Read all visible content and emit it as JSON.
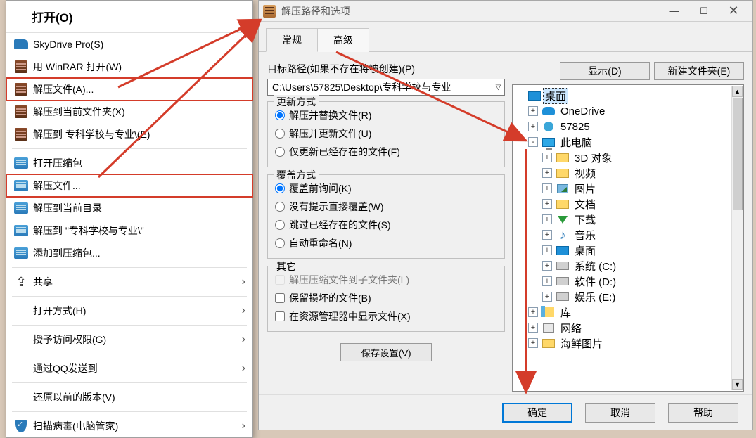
{
  "context_menu": {
    "header": "打开(O)",
    "items": [
      {
        "label": "SkyDrive Pro(S)",
        "icon": "skydrive"
      },
      {
        "label": "用 WinRAR 打开(W)",
        "icon": "rar"
      },
      {
        "label": "解压文件(A)...",
        "icon": "rar",
        "highlighted": true
      },
      {
        "label": "解压到当前文件夹(X)",
        "icon": "rar"
      },
      {
        "label": "解压到 专科学校与专业\\(E)",
        "icon": "rar"
      },
      {
        "sep": true
      },
      {
        "label": "打开压缩包",
        "icon": "rar2"
      },
      {
        "label": "解压文件...",
        "icon": "rar2",
        "highlighted": true
      },
      {
        "label": "解压到当前目录",
        "icon": "rar2"
      },
      {
        "label": "解压到 \"专科学校与专业\\\"",
        "icon": "rar2"
      },
      {
        "label": "添加到压缩包...",
        "icon": "rar2"
      },
      {
        "sep": true
      },
      {
        "label": "共享",
        "icon": "share",
        "chev": true
      },
      {
        "sep": true
      },
      {
        "label": "打开方式(H)",
        "chev": true
      },
      {
        "sep": true
      },
      {
        "label": "授予访问权限(G)",
        "chev": true
      },
      {
        "sep": true
      },
      {
        "label": "通过QQ发送到",
        "chev": true
      },
      {
        "sep": true
      },
      {
        "label": "还原以前的版本(V)"
      },
      {
        "sep": true
      },
      {
        "label": "扫描病毒(电脑管家)",
        "icon": "shield",
        "chev": true
      }
    ]
  },
  "dialog": {
    "title": "解压路径和选项",
    "tabs": {
      "general": "常规",
      "advanced": "高级"
    },
    "path_label": "目标路径(如果不存在将被创建)(P)",
    "path_value": "C:\\Users\\57825\\Desktop\\专科学校与专业",
    "btn_show": "显示(D)",
    "btn_newfolder": "新建文件夹(E)",
    "update_group": {
      "title": "更新方式",
      "o1": "解压并替换文件(R)",
      "o2": "解压并更新文件(U)",
      "o3": "仅更新已经存在的文件(F)"
    },
    "overwrite_group": {
      "title": "覆盖方式",
      "o1": "覆盖前询问(K)",
      "o2": "没有提示直接覆盖(W)",
      "o3": "跳过已经存在的文件(S)",
      "o4": "自动重命名(N)"
    },
    "misc_group": {
      "title": "其它",
      "c1": "解压压缩文件到子文件夹(L)",
      "c2": "保留损坏的文件(B)",
      "c3": "在资源管理器中显示文件(X)"
    },
    "save_btn": "保存设置(V)",
    "footer": {
      "ok": "确定",
      "cancel": "取消",
      "help": "帮助"
    }
  },
  "tree": [
    {
      "label": "桌面",
      "icon": "desktop",
      "indent": 0,
      "sel": true
    },
    {
      "label": "OneDrive",
      "icon": "onedrive",
      "indent": 1,
      "exp": "+"
    },
    {
      "label": "57825",
      "icon": "user",
      "indent": 1,
      "exp": "+"
    },
    {
      "label": "此电脑",
      "icon": "monitor",
      "indent": 1,
      "exp": "-"
    },
    {
      "label": "3D 对象",
      "icon": "folder",
      "indent": 2,
      "exp": "+"
    },
    {
      "label": "视频",
      "icon": "folder",
      "indent": 2,
      "exp": "+"
    },
    {
      "label": "图片",
      "icon": "img",
      "indent": 2,
      "exp": "+"
    },
    {
      "label": "文档",
      "icon": "folder",
      "indent": 2,
      "exp": "+"
    },
    {
      "label": "下载",
      "icon": "down",
      "indent": 2,
      "exp": "+"
    },
    {
      "label": "音乐",
      "icon": "music",
      "indent": 2,
      "exp": "+"
    },
    {
      "label": "桌面",
      "icon": "desktop",
      "indent": 2,
      "exp": "+"
    },
    {
      "label": "系统 (C:)",
      "icon": "drive",
      "indent": 2,
      "exp": "+"
    },
    {
      "label": "软件 (D:)",
      "icon": "drive",
      "indent": 2,
      "exp": "+"
    },
    {
      "label": "娱乐 (E:)",
      "icon": "drive",
      "indent": 2,
      "exp": "+"
    },
    {
      "label": "库",
      "icon": "lib",
      "indent": 1,
      "exp": "+"
    },
    {
      "label": "网络",
      "icon": "net",
      "indent": 1,
      "exp": "+"
    },
    {
      "label": "海鲜图片",
      "icon": "folder",
      "indent": 1,
      "exp": "+"
    }
  ]
}
